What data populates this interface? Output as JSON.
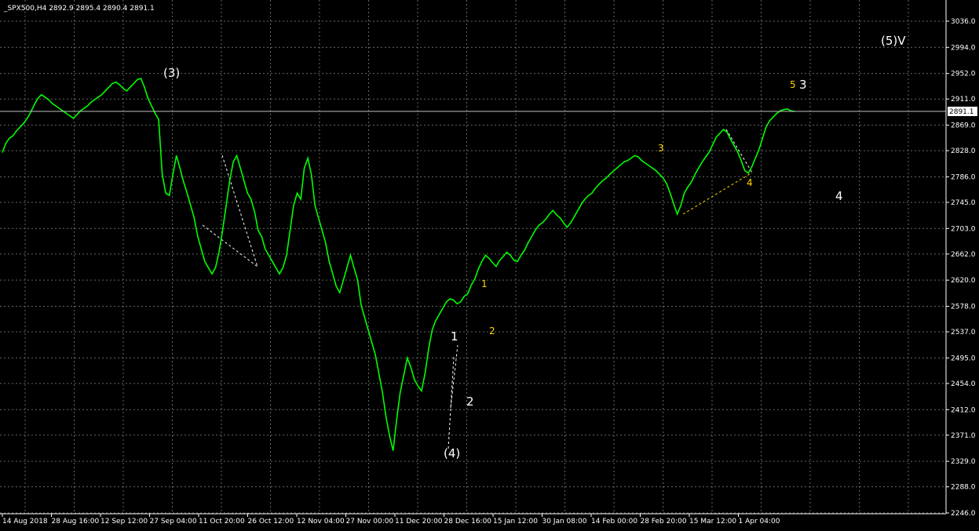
{
  "header": {
    "text": "_SPX500,H4  2892.9 2895.4 2890.4 2891.1"
  },
  "current_price_label": "2891.1",
  "colors": {
    "background": "#000000",
    "grid": "#5f6b5f",
    "series": "#00ff00",
    "axis": "#ffffff",
    "wave_white": "#ffffff",
    "wave_yellow": "#ffd700"
  },
  "chart_data": {
    "type": "line",
    "symbol": "_SPX500",
    "timeframe": "H4",
    "ohlc": {
      "open": 2892.9,
      "high": 2895.4,
      "low": 2890.4,
      "close": 2891.1
    },
    "current_price": 2891.1,
    "ylim": [
      2246.0,
      3036.0
    ],
    "yticks": [
      "3036.0",
      "2994.0",
      "2952.0",
      "2911.0",
      "2869.0",
      "2828.0",
      "2786.0",
      "2745.0",
      "2703.0",
      "2662.0",
      "2620.0",
      "2578.0",
      "2537.0",
      "2495.0",
      "2454.0",
      "2412.0",
      "2371.0",
      "2329.0",
      "2288.0",
      "2246.0"
    ],
    "xticks": [
      "14 Aug 2018",
      "28 Aug 16:00",
      "12 Sep 12:00",
      "27 Sep 04:00",
      "11 Oct 20:00",
      "26 Oct 12:00",
      "12 Nov 04:00",
      "27 Nov 00:00",
      "11 Dec 20:00",
      "28 Dec 16:00",
      "15 Jan 12:00",
      "30 Jan 08:00",
      "14 Feb 00:00",
      "28 Feb 20:00",
      "15 Mar 12:00",
      "1 Apr 04:00"
    ],
    "grid": true,
    "series": [
      {
        "values": [
          2825,
          2840,
          2848,
          2852,
          2860,
          2866,
          2872,
          2880,
          2890,
          2902,
          2912,
          2918,
          2914,
          2910,
          2904,
          2900,
          2896,
          2892,
          2888,
          2884,
          2880,
          2886,
          2892,
          2896,
          2900,
          2906,
          2910,
          2914,
          2918,
          2924,
          2930,
          2936,
          2938,
          2934,
          2928,
          2924,
          2930,
          2936,
          2942,
          2944,
          2930,
          2912,
          2900,
          2888,
          2878,
          2790,
          2760,
          2756,
          2790,
          2820,
          2800,
          2778,
          2760,
          2740,
          2720,
          2690,
          2670,
          2650,
          2640,
          2630,
          2640,
          2665,
          2700,
          2740,
          2780,
          2810,
          2820,
          2800,
          2780,
          2760,
          2750,
          2730,
          2700,
          2690,
          2670,
          2660,
          2650,
          2640,
          2630,
          2640,
          2660,
          2700,
          2740,
          2760,
          2750,
          2800,
          2816,
          2790,
          2740,
          2720,
          2700,
          2680,
          2650,
          2630,
          2610,
          2600,
          2620,
          2640,
          2660,
          2640,
          2620,
          2580,
          2560,
          2540,
          2520,
          2500,
          2470,
          2440,
          2400,
          2370,
          2346,
          2395,
          2440,
          2467,
          2495,
          2480,
          2460,
          2450,
          2442,
          2470,
          2510,
          2540,
          2555,
          2565,
          2575,
          2585,
          2590,
          2588,
          2582,
          2585,
          2594,
          2598,
          2612,
          2622,
          2638,
          2650,
          2660,
          2655,
          2648,
          2642,
          2652,
          2658,
          2665,
          2660,
          2652,
          2650,
          2660,
          2668,
          2680,
          2690,
          2700,
          2708,
          2712,
          2718,
          2726,
          2732,
          2725,
          2720,
          2712,
          2705,
          2712,
          2722,
          2732,
          2742,
          2750,
          2756,
          2760,
          2768,
          2774,
          2780,
          2784,
          2790,
          2795,
          2800,
          2805,
          2810,
          2812,
          2816,
          2820,
          2818,
          2812,
          2808,
          2804,
          2800,
          2796,
          2790,
          2784,
          2775,
          2760,
          2742,
          2726,
          2740,
          2760,
          2770,
          2778,
          2790,
          2800,
          2810,
          2818,
          2826,
          2838,
          2850,
          2856,
          2862,
          2858,
          2846,
          2836,
          2826,
          2812,
          2796,
          2792,
          2802,
          2816,
          2830,
          2848,
          2866,
          2876,
          2882,
          2888,
          2892,
          2894,
          2895,
          2892,
          2891
        ]
      }
    ]
  },
  "annotations": {
    "w3": "(3)",
    "w4": "(4)",
    "w5v": "(5)V",
    "w1": "1",
    "w2": "2",
    "w3b": "3",
    "w4b": "4",
    "y1": "1",
    "y2": "2",
    "y3": "3",
    "y4": "4",
    "y5": "5"
  }
}
